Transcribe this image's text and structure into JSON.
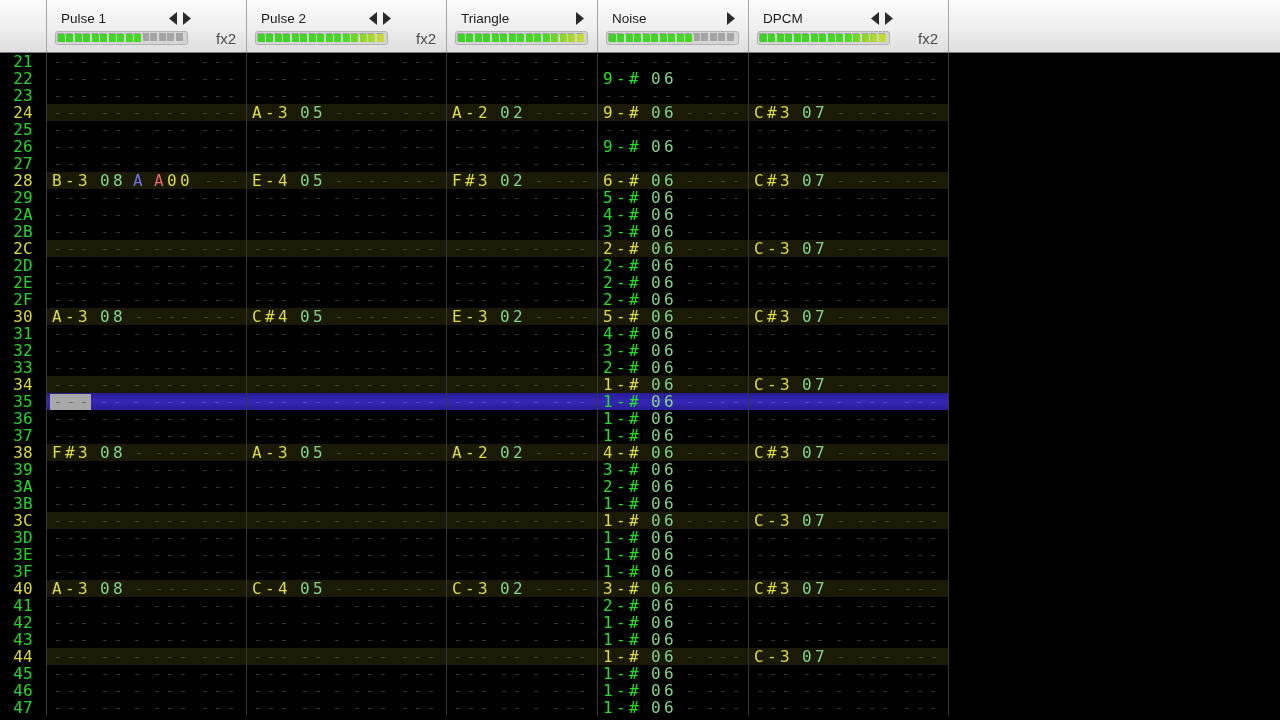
{
  "channels": [
    {
      "name": "Pulse 1",
      "kind": "double",
      "left_arrow": true,
      "right_arrow": true,
      "level": 0.667,
      "effects_label": "fx2"
    },
    {
      "name": "Pulse 2",
      "kind": "double",
      "left_arrow": true,
      "right_arrow": true,
      "level": 1,
      "effects_label": "fx2"
    },
    {
      "name": "Triangle",
      "kind": "single",
      "left_arrow": false,
      "right_arrow": true,
      "level": 1
    },
    {
      "name": "Noise",
      "kind": "single",
      "left_arrow": false,
      "right_arrow": true,
      "level": 0.667
    },
    {
      "name": "DPCM",
      "kind": "double",
      "left_arrow": true,
      "right_arrow": true,
      "level": 1,
      "effects_label": "fx2"
    }
  ],
  "rows": [
    {
      "number": "21",
      "highlight": false,
      "selected": false,
      "cells": [
        {},
        {},
        {},
        {},
        {}
      ]
    },
    {
      "number": "22",
      "highlight": false,
      "selected": false,
      "cells": [
        {},
        {},
        {},
        {
          "note": "9-#",
          "instrument": "06"
        },
        {}
      ]
    },
    {
      "number": "23",
      "highlight": false,
      "selected": false,
      "cells": [
        {},
        {},
        {},
        {},
        {}
      ]
    },
    {
      "number": "24",
      "highlight": true,
      "selected": false,
      "cells": [
        {},
        {
          "note": "A-3",
          "instrument": "05"
        },
        {
          "note": "A-2",
          "instrument": "02"
        },
        {
          "note": "9-#",
          "instrument": "06"
        },
        {
          "note": "C#3",
          "instrument": "07"
        }
      ]
    },
    {
      "number": "25",
      "highlight": false,
      "selected": false,
      "cells": [
        {},
        {},
        {},
        {},
        {}
      ]
    },
    {
      "number": "26",
      "highlight": false,
      "selected": false,
      "cells": [
        {},
        {},
        {},
        {
          "note": "9-#",
          "instrument": "06"
        },
        {}
      ]
    },
    {
      "number": "27",
      "highlight": false,
      "selected": false,
      "cells": [
        {},
        {},
        {},
        {},
        {}
      ]
    },
    {
      "number": "28",
      "highlight": true,
      "selected": false,
      "cells": [
        {
          "note": "B-3",
          "instrument": "08",
          "volume": "A",
          "effects": [
            "A00"
          ]
        },
        {
          "note": "E-4",
          "instrument": "05"
        },
        {
          "note": "F#3",
          "instrument": "02"
        },
        {
          "note": "6-#",
          "instrument": "06"
        },
        {
          "note": "C#3",
          "instrument": "07"
        }
      ]
    },
    {
      "number": "29",
      "highlight": false,
      "selected": false,
      "cells": [
        {},
        {},
        {},
        {
          "note": "5-#",
          "instrument": "06"
        },
        {}
      ]
    },
    {
      "number": "2A",
      "highlight": false,
      "selected": false,
      "cells": [
        {},
        {},
        {},
        {
          "note": "4-#",
          "instrument": "06"
        },
        {}
      ]
    },
    {
      "number": "2B",
      "highlight": false,
      "selected": false,
      "cells": [
        {},
        {},
        {},
        {
          "note": "3-#",
          "instrument": "06"
        },
        {}
      ]
    },
    {
      "number": "2C",
      "highlight": true,
      "selected": false,
      "cells": [
        {},
        {},
        {},
        {
          "note": "2-#",
          "instrument": "06"
        },
        {
          "note": "C-3",
          "instrument": "07"
        }
      ]
    },
    {
      "number": "2D",
      "highlight": false,
      "selected": false,
      "cells": [
        {},
        {},
        {},
        {
          "note": "2-#",
          "instrument": "06"
        },
        {}
      ]
    },
    {
      "number": "2E",
      "highlight": false,
      "selected": false,
      "cells": [
        {},
        {},
        {},
        {
          "note": "2-#",
          "instrument": "06"
        },
        {}
      ]
    },
    {
      "number": "2F",
      "highlight": false,
      "selected": false,
      "cells": [
        {},
        {},
        {},
        {
          "note": "2-#",
          "instrument": "06"
        },
        {}
      ]
    },
    {
      "number": "30",
      "highlight": true,
      "selected": false,
      "cells": [
        {
          "note": "A-3",
          "instrument": "08"
        },
        {
          "note": "C#4",
          "instrument": "05"
        },
        {
          "note": "E-3",
          "instrument": "02"
        },
        {
          "note": "5-#",
          "instrument": "06"
        },
        {
          "note": "C#3",
          "instrument": "07"
        }
      ]
    },
    {
      "number": "31",
      "highlight": false,
      "selected": false,
      "cells": [
        {},
        {},
        {},
        {
          "note": "4-#",
          "instrument": "06"
        },
        {}
      ]
    },
    {
      "number": "32",
      "highlight": false,
      "selected": false,
      "cells": [
        {},
        {},
        {},
        {
          "note": "3-#",
          "instrument": "06"
        },
        {}
      ]
    },
    {
      "number": "33",
      "highlight": false,
      "selected": false,
      "cells": [
        {},
        {},
        {},
        {
          "note": "2-#",
          "instrument": "06"
        },
        {}
      ]
    },
    {
      "number": "34",
      "highlight": true,
      "selected": false,
      "cells": [
        {},
        {},
        {},
        {
          "note": "1-#",
          "instrument": "06"
        },
        {
          "note": "C-3",
          "instrument": "07"
        }
      ]
    },
    {
      "number": "35",
      "highlight": false,
      "selected": true,
      "cells": [
        {
          "cursor": true
        },
        {},
        {},
        {
          "note": "1-#",
          "instrument": "06"
        },
        {}
      ]
    },
    {
      "number": "36",
      "highlight": false,
      "selected": false,
      "cells": [
        {},
        {},
        {},
        {
          "note": "1-#",
          "instrument": "06"
        },
        {}
      ]
    },
    {
      "number": "37",
      "highlight": false,
      "selected": false,
      "cells": [
        {},
        {},
        {},
        {
          "note": "1-#",
          "instrument": "06"
        },
        {}
      ]
    },
    {
      "number": "38",
      "highlight": true,
      "selected": false,
      "cells": [
        {
          "note": "F#3",
          "instrument": "08"
        },
        {
          "note": "A-3",
          "instrument": "05"
        },
        {
          "note": "A-2",
          "instrument": "02"
        },
        {
          "note": "4-#",
          "instrument": "06"
        },
        {
          "note": "C#3",
          "instrument": "07"
        }
      ]
    },
    {
      "number": "39",
      "highlight": false,
      "selected": false,
      "cells": [
        {},
        {},
        {},
        {
          "note": "3-#",
          "instrument": "06"
        },
        {}
      ]
    },
    {
      "number": "3A",
      "highlight": false,
      "selected": false,
      "cells": [
        {},
        {},
        {},
        {
          "note": "2-#",
          "instrument": "06"
        },
        {}
      ]
    },
    {
      "number": "3B",
      "highlight": false,
      "selected": false,
      "cells": [
        {},
        {},
        {},
        {
          "note": "1-#",
          "instrument": "06"
        },
        {}
      ]
    },
    {
      "number": "3C",
      "highlight": true,
      "selected": false,
      "cells": [
        {},
        {},
        {},
        {
          "note": "1-#",
          "instrument": "06"
        },
        {
          "note": "C-3",
          "instrument": "07"
        }
      ]
    },
    {
      "number": "3D",
      "highlight": false,
      "selected": false,
      "cells": [
        {},
        {},
        {},
        {
          "note": "1-#",
          "instrument": "06"
        },
        {}
      ]
    },
    {
      "number": "3E",
      "highlight": false,
      "selected": false,
      "cells": [
        {},
        {},
        {},
        {
          "note": "1-#",
          "instrument": "06"
        },
        {}
      ]
    },
    {
      "number": "3F",
      "highlight": false,
      "selected": false,
      "cells": [
        {},
        {},
        {},
        {
          "note": "1-#",
          "instrument": "06"
        },
        {}
      ]
    },
    {
      "number": "40",
      "highlight": true,
      "selected": false,
      "cells": [
        {
          "note": "A-3",
          "instrument": "08"
        },
        {
          "note": "C-4",
          "instrument": "05"
        },
        {
          "note": "C-3",
          "instrument": "02"
        },
        {
          "note": "3-#",
          "instrument": "06"
        },
        {
          "note": "C#3",
          "instrument": "07"
        }
      ]
    },
    {
      "number": "41",
      "highlight": false,
      "selected": false,
      "cells": [
        {},
        {},
        {},
        {
          "note": "2-#",
          "instrument": "06"
        },
        {}
      ]
    },
    {
      "number": "42",
      "highlight": false,
      "selected": false,
      "cells": [
        {},
        {},
        {},
        {
          "note": "1-#",
          "instrument": "06"
        },
        {}
      ]
    },
    {
      "number": "43",
      "highlight": false,
      "selected": false,
      "cells": [
        {},
        {},
        {},
        {
          "note": "1-#",
          "instrument": "06"
        },
        {}
      ]
    },
    {
      "number": "44",
      "highlight": true,
      "selected": false,
      "cells": [
        {},
        {},
        {},
        {
          "note": "1-#",
          "instrument": "06"
        },
        {
          "note": "C-3",
          "instrument": "07"
        }
      ]
    },
    {
      "number": "45",
      "highlight": false,
      "selected": false,
      "cells": [
        {},
        {},
        {},
        {
          "note": "1-#",
          "instrument": "06"
        },
        {}
      ]
    },
    {
      "number": "46",
      "highlight": false,
      "selected": false,
      "cells": [
        {},
        {},
        {},
        {
          "note": "1-#",
          "instrument": "06"
        },
        {}
      ]
    },
    {
      "number": "47",
      "highlight": false,
      "selected": false,
      "cells": [
        {},
        {},
        {},
        {
          "note": "1-#",
          "instrument": "06"
        },
        {}
      ]
    }
  ]
}
